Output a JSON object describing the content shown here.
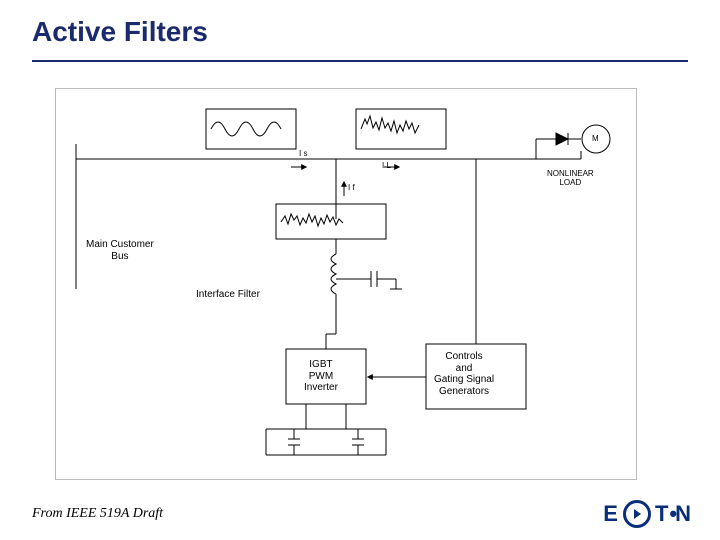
{
  "title": "Active Filters",
  "credit": "From IEEE 519A Draft",
  "brand": "E T   N",
  "diagram": {
    "labels": {
      "main_bus": "Main Customer\nBus",
      "interface_filter": "Interface Filter",
      "igbt": "IGBT\nPWM\nInverter",
      "controls": "Controls\nand\nGating Signal\nGenerators",
      "nonlinear": "NONLINEAR\nLOAD",
      "is": "I s",
      "il": "I L",
      "if": "I f",
      "m": "M"
    }
  }
}
